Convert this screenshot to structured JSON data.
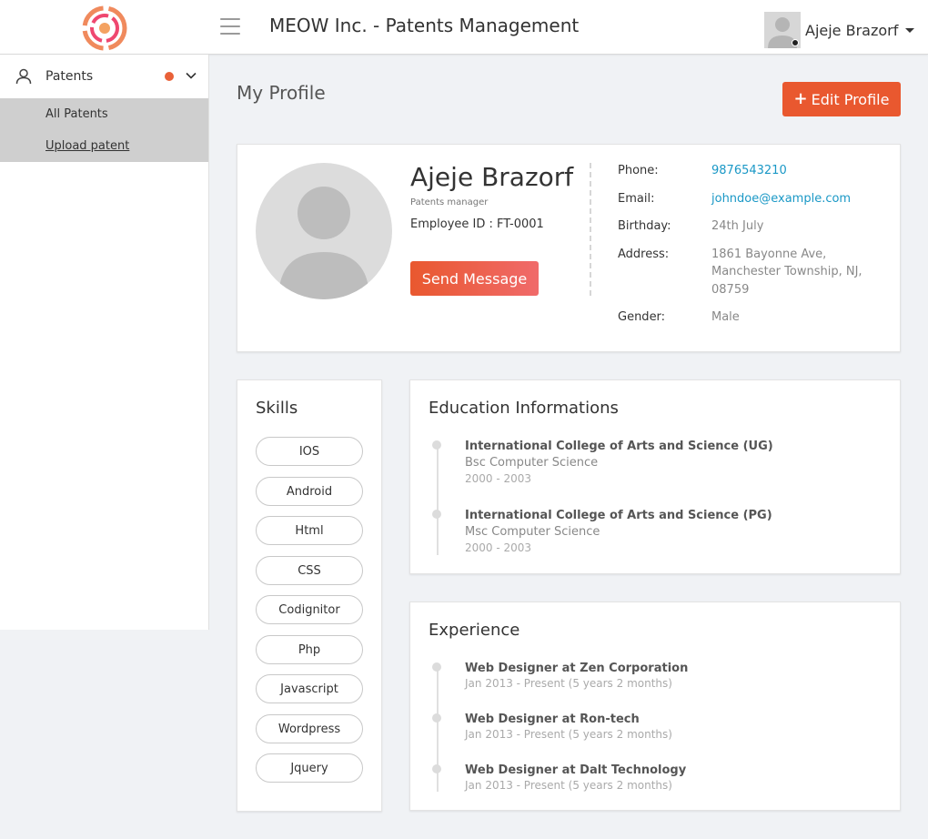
{
  "header": {
    "app_title": "MEOW Inc. - Patents Management",
    "user_name": "Ajeje Brazorf",
    "logo_colors": [
      "#f4a261",
      "#e76f51",
      "#ef476f"
    ]
  },
  "sidebar": {
    "section_label": "Patents",
    "badge_color": "#e96138",
    "items": [
      {
        "label": "All Patents"
      },
      {
        "label": "Upload patent"
      }
    ]
  },
  "page": {
    "title": "My Profile",
    "edit_button": "Edit Profile",
    "edit_icon": "+"
  },
  "profile": {
    "name": "Ajeje Brazorf",
    "role": "Patents manager",
    "employee_id": "Employee ID : FT-0001",
    "send_button": "Send Message",
    "fields": [
      {
        "key": "Phone:",
        "value": "9876543210",
        "link": true
      },
      {
        "key": "Email:",
        "value": "johndoe@example.com",
        "link": true
      },
      {
        "key": "Birthday:",
        "value": "24th July",
        "link": false
      },
      {
        "key": "Address:",
        "value": "1861 Bayonne Ave, Manchester Township, NJ, 08759",
        "link": false
      },
      {
        "key": "Gender:",
        "value": "Male",
        "link": false
      }
    ]
  },
  "skills": {
    "title": "Skills",
    "items": [
      "IOS",
      "Android",
      "Html",
      "CSS",
      "Codignitor",
      "Php",
      "Javascript",
      "Wordpress",
      "Jquery"
    ]
  },
  "education": {
    "title": "Education Informations",
    "items": [
      {
        "school": "International College of Arts and Science (UG)",
        "degree": "Bsc Computer Science",
        "years": "2000 - 2003"
      },
      {
        "school": "International College of Arts and Science (PG)",
        "degree": "Msc Computer Science",
        "years": "2000 - 2003"
      }
    ]
  },
  "experience": {
    "title": "Experience",
    "items": [
      {
        "role": "Web Designer at Zen Corporation",
        "period": "Jan 2013 - Present (5 years 2 months)"
      },
      {
        "role": "Web Designer at Ron-tech",
        "period": "Jan 2013 - Present (5 years 2 months)"
      },
      {
        "role": "Web Designer at Dalt Technology",
        "period": "Jan 2013 - Present (5 years 2 months)"
      }
    ]
  }
}
